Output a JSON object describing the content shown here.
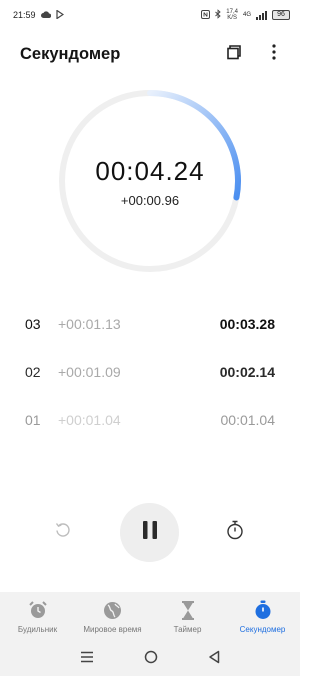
{
  "status_bar": {
    "time": "21:59",
    "net_speed": "17,4",
    "net_unit": "K/S",
    "network_type": "4G",
    "battery": "96"
  },
  "header": {
    "title": "Секундомер"
  },
  "stopwatch": {
    "main_time": "00:04.24",
    "lap_time": "+00:00.96",
    "progress_fraction": 0.28,
    "accent_color": "#4a8ef0"
  },
  "laps": [
    {
      "number": "03",
      "diff": "+00:01.13",
      "total": "00:03.28"
    },
    {
      "number": "02",
      "diff": "+00:01.09",
      "total": "00:02.14"
    },
    {
      "number": "01",
      "diff": "+00:01.04",
      "total": "00:01.04"
    }
  ],
  "controls": {
    "reset_icon": "reset-icon",
    "pause_icon": "pause-icon",
    "lap_icon": "timer-icon"
  },
  "nav": {
    "tabs": [
      {
        "label": "Будильник",
        "icon": "alarm-clock-icon"
      },
      {
        "label": "Мировое время",
        "icon": "globe-icon"
      },
      {
        "label": "Таймер",
        "icon": "hourglass-icon"
      },
      {
        "label": "Секундомер",
        "icon": "stopwatch-icon"
      }
    ],
    "active_color": "#1f6fe0"
  }
}
